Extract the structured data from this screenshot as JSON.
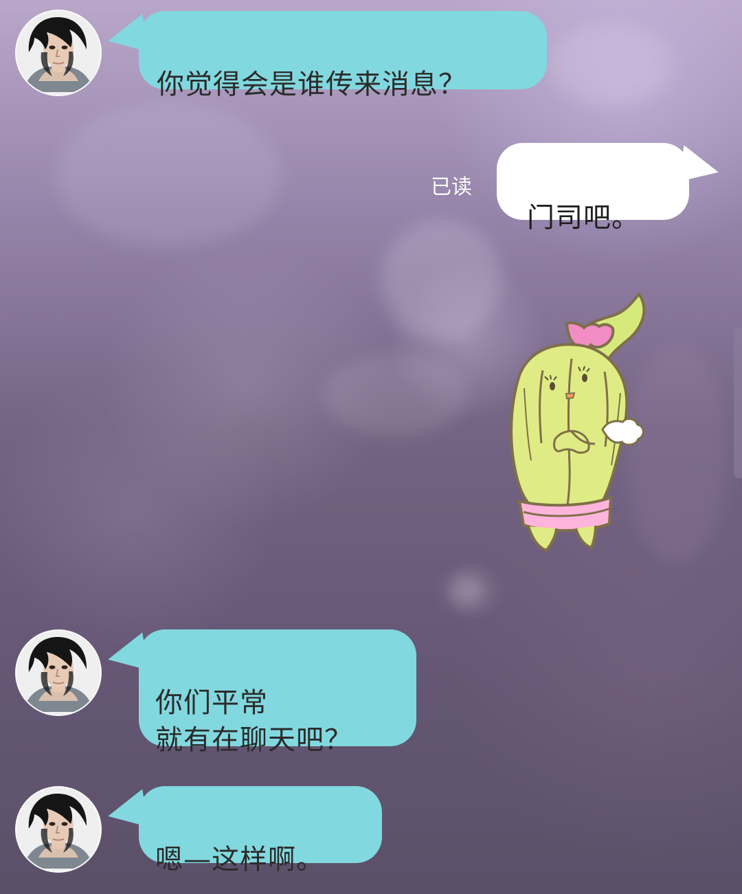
{
  "chat": {
    "messages": [
      {
        "side": "incoming",
        "text": "你觉得会是谁传来消息？"
      },
      {
        "side": "outgoing",
        "read_status": "已读",
        "text": "门司吧。"
      },
      {
        "side": "outgoing",
        "type": "sticker",
        "icon": "cactus-sticker-icon"
      },
      {
        "side": "incoming",
        "text": "你们平常\n就有在聊天吧？"
      },
      {
        "side": "incoming",
        "text": "嗯—这样啊。"
      }
    ]
  },
  "colors": {
    "incoming_bubble": "#82d8df",
    "outgoing_bubble": "#ffffff",
    "read_status": "#ffffff",
    "background_top": "#b8a7c9",
    "background_bottom": "#5b5068"
  }
}
